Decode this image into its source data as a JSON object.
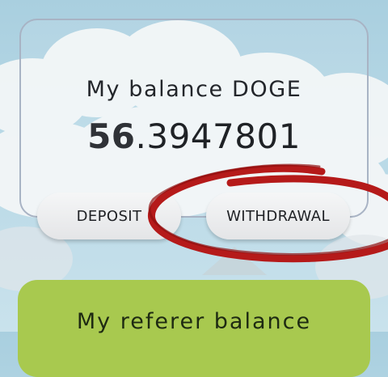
{
  "balance": {
    "title": "My balance DOGE",
    "value_int": "56",
    "value_frac": ".3947801"
  },
  "actions": {
    "deposit_label": "DEPOSIT",
    "withdrawal_label": "WITHDRAWAL"
  },
  "referer": {
    "title": "My referer balance"
  },
  "colors": {
    "sky": "#b7d8e6",
    "card_border": "#a8b3c4",
    "referer_card": "#a8c94f",
    "annotation": "#b51a1a"
  }
}
